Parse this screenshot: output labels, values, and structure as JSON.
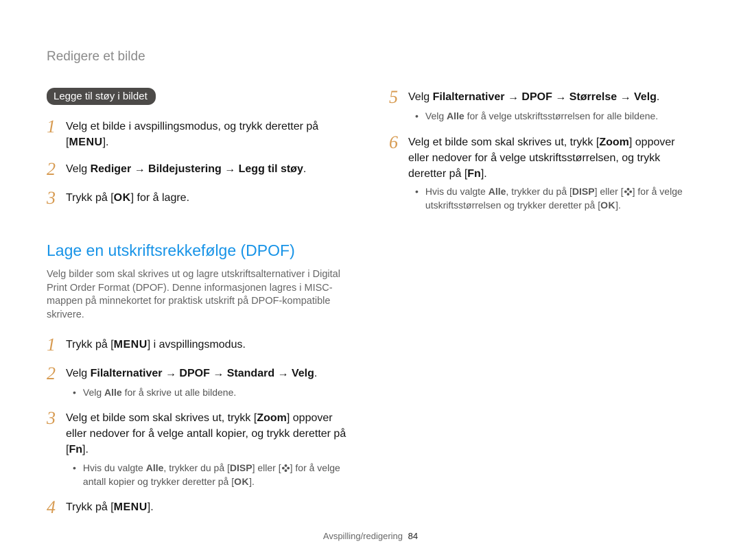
{
  "header": "Redigere et bilde",
  "left": {
    "badge": "Legge til støy i bildet",
    "step1": {
      "text_a": "Velg et bilde i avspillingsmodus, og trykk deretter på [",
      "menu": "MENU",
      "text_b": "]."
    },
    "step2": {
      "prefix": "Velg ",
      "bold": "Rediger → Bildejustering → Legg til støy",
      "suffix": "."
    },
    "step3": {
      "a": "Trykk på [",
      "ok": "OK",
      "b": "] for å lagre."
    },
    "section_title": "Lage en utskriftsrekkefølge (DPOF)",
    "section_desc": "Velg bilder som skal skrives ut og lagre utskriftsalternativer i Digital Print Order Format (DPOF). Denne informasjonen lagres i MISC-mappen på minnekortet for praktisk utskrift på DPOF-kompatible skrivere.",
    "b_step1": {
      "a": "Trykk på [",
      "menu": "MENU",
      "b": "] i avspillingsmodus."
    },
    "b_step2": {
      "prefix": "Velg ",
      "bold": "Filalternativer → DPOF → Standard → Velg",
      "suffix": "."
    },
    "b_bullet2": {
      "a": "Velg ",
      "alle": "Alle",
      "b": " for å skrive ut alle bildene."
    },
    "b_step3": {
      "a": "Velg et bilde som skal skrives ut, trykk [",
      "zoom": "Zoom",
      "b": "] oppover eller nedover for å velge antall kopier, og trykk deretter på [",
      "fn": "Fn",
      "c": "]."
    },
    "b_bullet3": {
      "a": "Hvis du valgte ",
      "alle": "Alle",
      "b": ", trykker du på [",
      "disp": "DISP",
      "c": "] eller [",
      "d": "] for å velge antall kopier og trykker deretter på [",
      "ok": "OK",
      "e": "]."
    },
    "b_step4": {
      "a": "Trykk på [",
      "menu": "MENU",
      "b": "]."
    }
  },
  "right": {
    "step5": {
      "prefix": "Velg ",
      "bold": "Filalternativer → DPOF → Størrelse → Velg",
      "suffix": "."
    },
    "bullet5": {
      "a": "Velg ",
      "alle": "Alle",
      "b": " for å velge utskriftsstørrelsen for alle bildene."
    },
    "step6": {
      "a": "Velg et bilde som skal skrives ut, trykk [",
      "zoom": "Zoom",
      "b": "] oppover eller nedover for å velge utskriftsstørrelsen, og trykk deretter på [",
      "fn": "Fn",
      "c": "]."
    },
    "bullet6": {
      "a": "Hvis du valgte ",
      "alle": "Alle",
      "b": ", trykker du på [",
      "disp": "DISP",
      "c": "] eller [",
      "d": "] for å velge utskriftsstørrelsen og trykker deretter på [",
      "ok": "OK",
      "e": "]."
    }
  },
  "footer": {
    "section": "Avspilling/redigering",
    "page": "84"
  }
}
